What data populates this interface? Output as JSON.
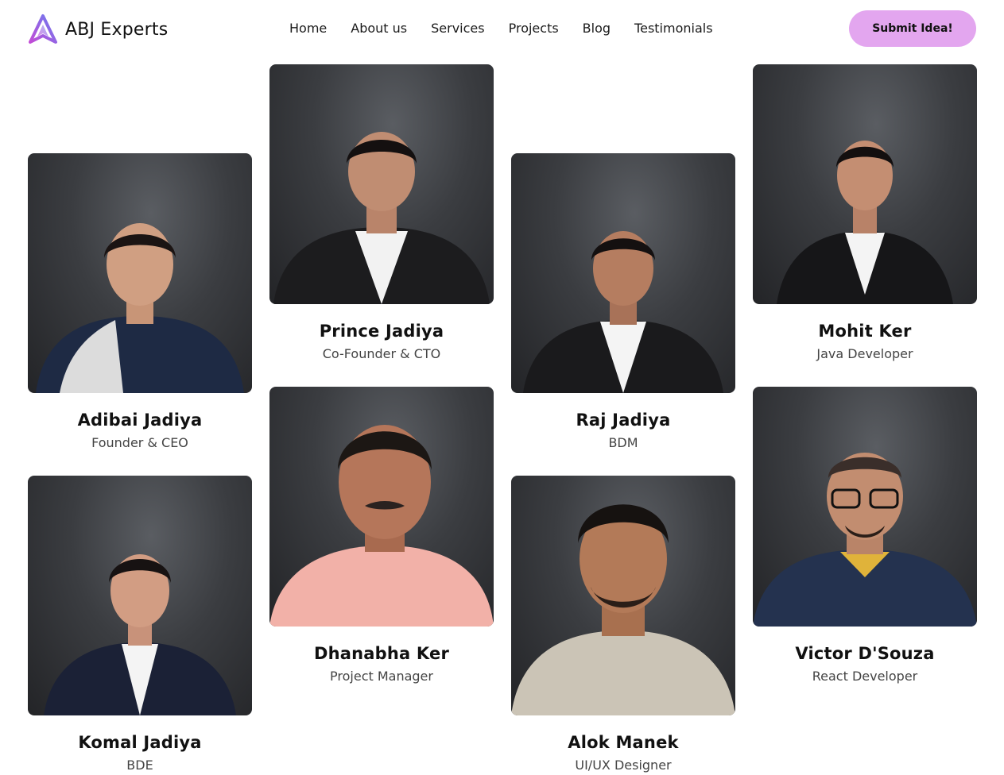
{
  "brand": {
    "name": "ABJ Experts",
    "logo_icon": "triangle-logo-icon"
  },
  "nav": [
    {
      "label": "Home"
    },
    {
      "label": "About us"
    },
    {
      "label": "Services"
    },
    {
      "label": "Projects"
    },
    {
      "label": "Blog"
    },
    {
      "label": "Testimonials"
    }
  ],
  "cta": {
    "label": "Submit Idea!",
    "color": "#e3a6ef"
  },
  "team": [
    {
      "name": "Adibai Jadiya",
      "role": "Founder & CEO"
    },
    {
      "name": "Prince Jadiya",
      "role": "Co-Founder & CTO"
    },
    {
      "name": "Raj Jadiya",
      "role": "BDM"
    },
    {
      "name": "Mohit Ker",
      "role": "Java Developer"
    },
    {
      "name": "Komal Jadiya",
      "role": "BDE"
    },
    {
      "name": "Dhanabha Ker",
      "role": "Project Manager"
    },
    {
      "name": "Alok Manek",
      "role": "UI/UX Designer"
    },
    {
      "name": "Victor D'Souza",
      "role": "React Developer"
    }
  ]
}
